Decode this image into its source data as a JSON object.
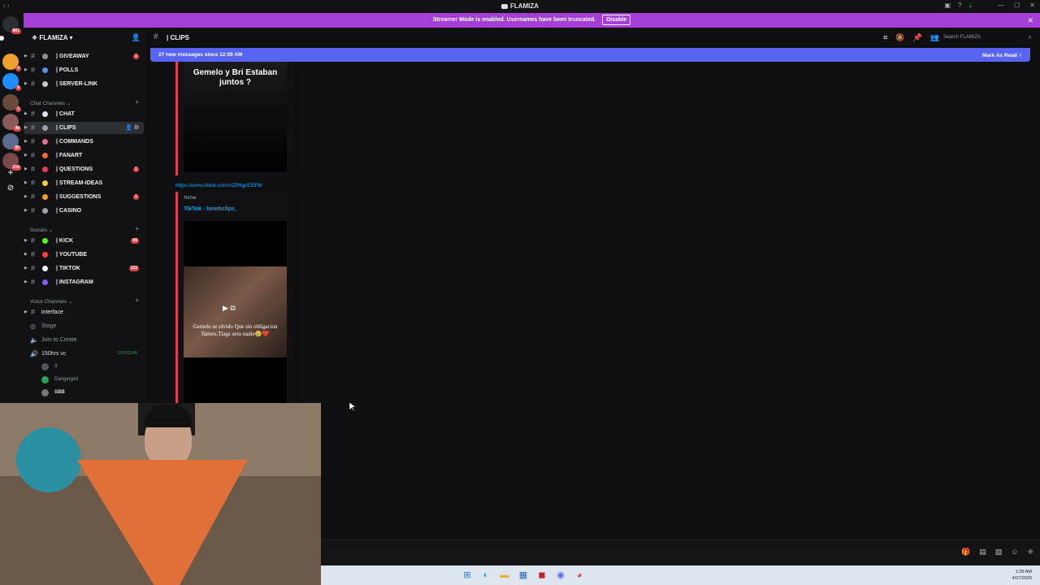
{
  "window": {
    "title": "FLAMIZA"
  },
  "banner": {
    "text": "Streamer Mode is enabled. Usernames have been truncated.",
    "disable": "Disable"
  },
  "rail": {
    "badges": [
      "801",
      "4",
      "9",
      "1",
      "48",
      "85",
      "216"
    ]
  },
  "guild": {
    "name": "FLAMIZA"
  },
  "channels_top": [
    {
      "label": "| GIVEAWAY",
      "count": "1",
      "emoji_color": "#8e9297"
    },
    {
      "label": "| POLLS",
      "count": "",
      "emoji_color": "#5b8def"
    },
    {
      "label": "| SERVER-LINK",
      "count": "",
      "emoji_color": "#c7c7c7"
    }
  ],
  "categories": {
    "chat": "Chat Channels",
    "socials": "Socials",
    "voice": "Voice Channels"
  },
  "channels_chat": [
    {
      "label": "| CHAT",
      "count": "",
      "emoji_color": "#dfe3e8"
    },
    {
      "label": "| CLIPS",
      "count": "",
      "emoji_color": "#9aa0a6",
      "active": true
    },
    {
      "label": "| COMMANDS",
      "count": "",
      "emoji_color": "#e26e8b"
    },
    {
      "label": "| FANART",
      "count": "",
      "emoji_color": "#f06b3c"
    },
    {
      "label": "| QUESTIONS",
      "count": "1",
      "emoji_color": "#e23d54"
    },
    {
      "label": "| STREAM-IDEAS",
      "count": "",
      "emoji_color": "#f7c948"
    },
    {
      "label": "| SUGGESTIONS",
      "count": "1",
      "emoji_color": "#f0a030"
    },
    {
      "label": "| CASINO",
      "count": "",
      "emoji_color": "#a0a4aa"
    }
  ],
  "channels_socials": [
    {
      "label": "| KICK",
      "count": "66",
      "emoji_color": "#53fc18"
    },
    {
      "label": "| YOUTUBE",
      "count": "",
      "emoji_color": "#ff3b3b"
    },
    {
      "label": "| TIKTOK",
      "count": "133",
      "emoji_color": "#f2f3f5"
    },
    {
      "label": "| INSTAGRAM",
      "count": "",
      "emoji_color": "#8b5cf6"
    }
  ],
  "voice": {
    "text_channel": "interface",
    "stage": "Stage",
    "join": "Join to Create",
    "live_channel": "150hrs vc",
    "timer": "120:03:06",
    "users": [
      "3",
      "Dangergxd",
      "SBB"
    ]
  },
  "header": {
    "channel": "| CLIPS",
    "search_placeholder": "Search FLAMIZA"
  },
  "newbar": {
    "text": "27 new messages since 12:59 AM",
    "mark": "Mark As Read"
  },
  "messages": {
    "caption_top": "Gemelo y Bri Estaban juntos ?",
    "link": "https://www.tiktok.com/t/ZP8gnEEFb/",
    "provider": "TikTok",
    "author": "TikTok · lonehclips_",
    "caption_bottom": "Gemelo se olvido Que sin obligacion flames,Tiagz sera nadie😢❤️"
  },
  "taskbar": {
    "time": "1:39 AM",
    "date": "4/27/2026"
  }
}
